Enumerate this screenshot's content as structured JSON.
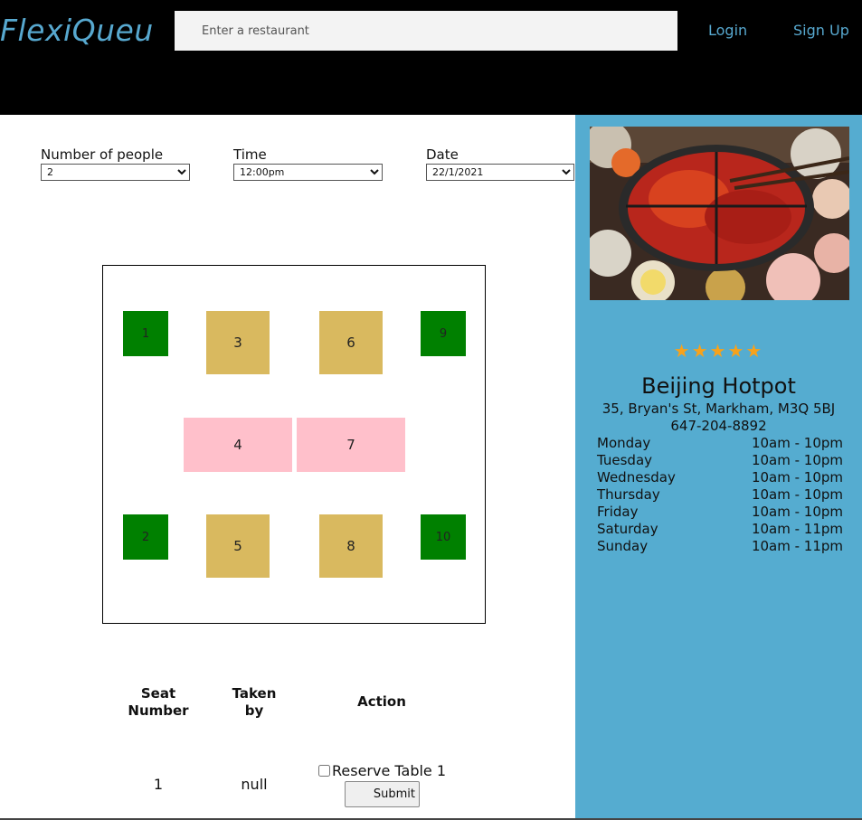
{
  "header": {
    "brand": "FlexiQueu",
    "search_placeholder": "Enter a restaurant",
    "login": "Login",
    "signup": "Sign Up"
  },
  "filters": {
    "people": {
      "label": "Number of people",
      "value": "2"
    },
    "time": {
      "label": "Time",
      "value": "12:00pm"
    },
    "date": {
      "label": "Date",
      "value": "22/1/2021"
    }
  },
  "colors": {
    "available": "#008000",
    "booth": "#d9b95f",
    "long_table": "#ffc0cb",
    "sidebar": "#55acd0",
    "brand": "#57a8cf",
    "stars": "#f7a21b"
  },
  "floor_plan": {
    "tables": [
      "1",
      "2",
      "3",
      "4",
      "5",
      "6",
      "7",
      "8",
      "9",
      "10"
    ]
  },
  "reservation_table": {
    "headers": {
      "seat": "Seat Number",
      "taken": "Taken by",
      "action": "Action"
    },
    "rows": [
      {
        "seat": "1",
        "taken": "null",
        "reserve_label": "Reserve Table 1",
        "checked": false
      }
    ],
    "submit": "Submit"
  },
  "restaurant": {
    "rating_stars": "★★★★★",
    "rating": 5,
    "name": "Beijing Hotpot",
    "address": "35, Bryan's St, Markham, M3Q 5BJ",
    "phone": "647-204-8892",
    "hours": [
      {
        "day": "Monday",
        "time": "10am - 10pm"
      },
      {
        "day": "Tuesday",
        "time": "10am - 10pm"
      },
      {
        "day": "Wednesday",
        "time": "10am - 10pm"
      },
      {
        "day": "Thursday",
        "time": "10am - 10pm"
      },
      {
        "day": "Friday",
        "time": "10am - 10pm"
      },
      {
        "day": "Saturday",
        "time": "10am - 11pm"
      },
      {
        "day": "Sunday",
        "time": "10am - 11pm"
      }
    ]
  }
}
